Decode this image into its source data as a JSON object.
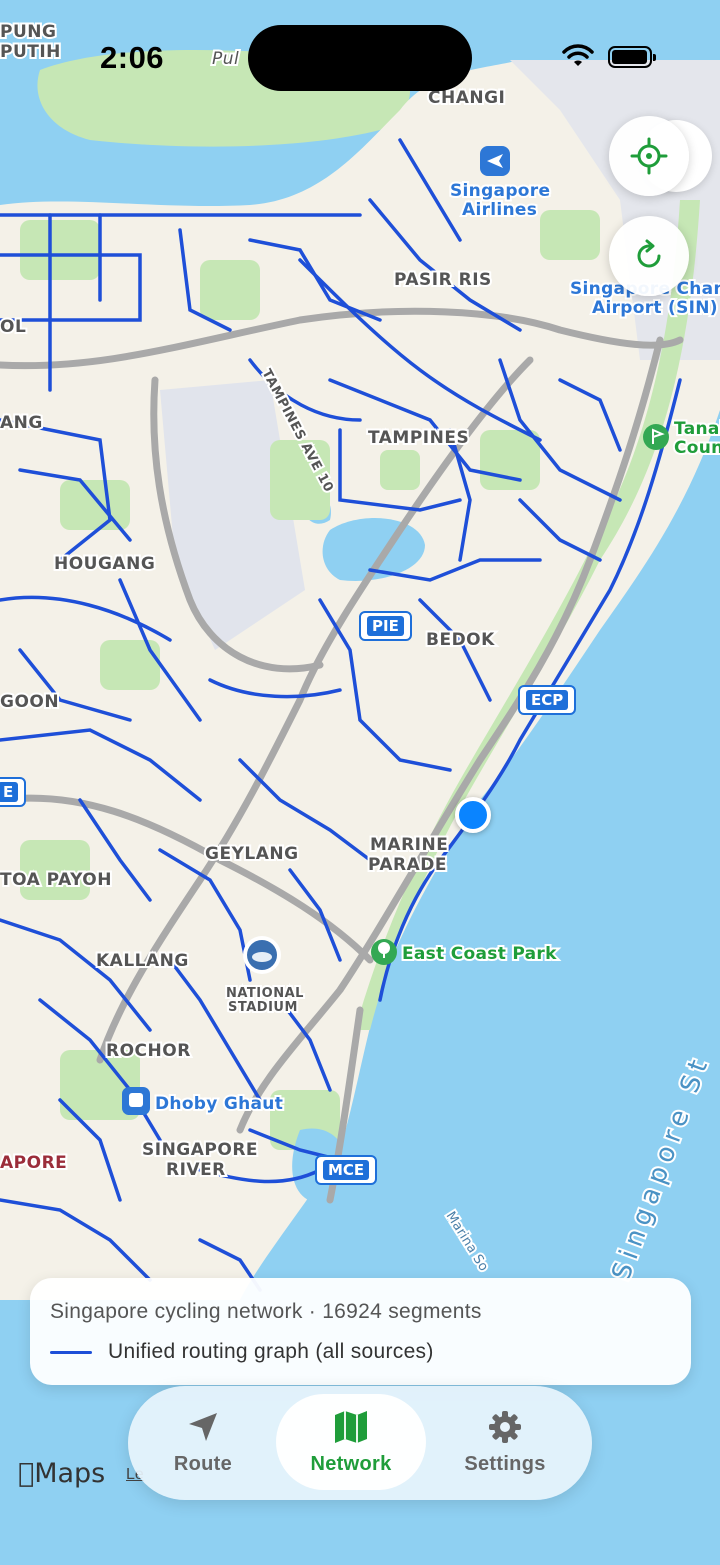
{
  "status_bar": {
    "time": "2:06"
  },
  "map": {
    "district_labels": [
      "PUNG",
      "PUTIH",
      "CHANGI",
      "PASIR RIS",
      "OL",
      "ANG",
      "TAMPINES",
      "TAMPINES AVE 10",
      "HOUGANG",
      "BEDOK",
      "GOON",
      "GEYLANG",
      "MARINE",
      "PARADE",
      "TOA PAYOH",
      "KALLANG",
      "NATIONAL",
      "STADIUM",
      "ROCHOR",
      "SINGAPORE",
      "RIVER",
      "APORE",
      "Pul"
    ],
    "poi_labels": [
      "Singapore",
      "Airlines",
      "Singapore Chang",
      "Airport (SIN)",
      "Tanah",
      "Coun",
      "East Coast Park",
      "Dhoby Ghaut",
      "Marina So",
      "Singapore St"
    ],
    "road_shields": [
      "PIE",
      "ECP",
      "MCE",
      "E"
    ],
    "colors": {
      "route": "#1e4fd8",
      "water": "#8fd0f2",
      "land": "#f4f1e8",
      "park": "#c6e7b5",
      "accent": "#1f9d3a"
    }
  },
  "legend": {
    "title": "Singapore cycling network · 16924 segments",
    "line_label": "Unified routing graph (all sources)"
  },
  "tabs": [
    {
      "label": "Route",
      "icon": "navigation-arrow-icon",
      "active": false
    },
    {
      "label": "Network",
      "icon": "map-icon",
      "active": true
    },
    {
      "label": "Settings",
      "icon": "gear-icon",
      "active": false
    }
  ],
  "maps_attribution": {
    "logo": "Maps",
    "legal": "Le"
  },
  "controls": {
    "locate_icon": "crosshair-icon",
    "refresh_icon": "refresh-icon"
  }
}
